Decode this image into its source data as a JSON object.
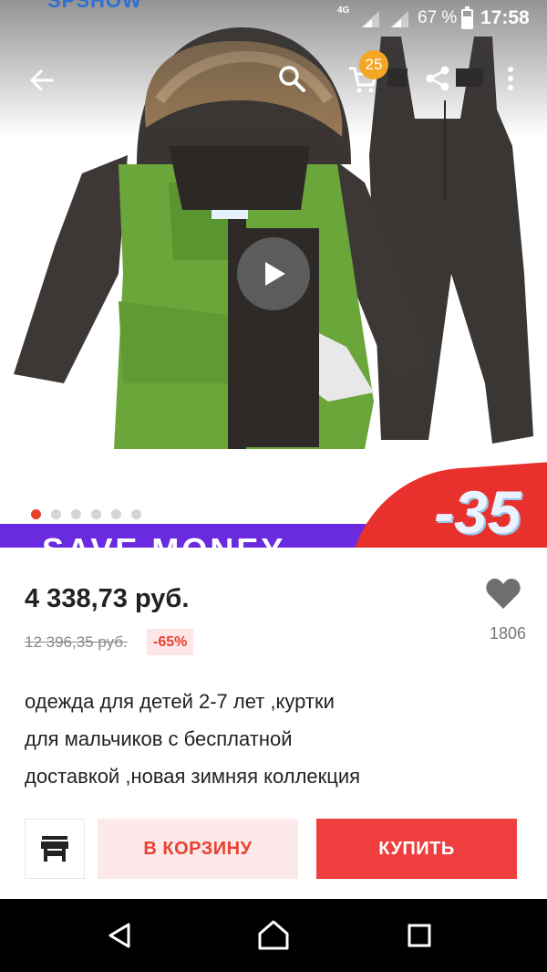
{
  "status_bar": {
    "network": "4G",
    "battery_percent": "67 %",
    "battery_level": 0.67,
    "time": "17:58"
  },
  "brand_clip_text": "SPSHOW",
  "toolbar": {
    "back_icon": "arrow-left-icon",
    "search_icon": "search-icon",
    "cart_icon": "cart-icon",
    "cart_count": "25",
    "share_icon": "share-icon",
    "more_icon": "more-vertical-icon"
  },
  "gallery": {
    "image_count": 6,
    "active_index": 0,
    "play_icon": "play-icon",
    "banner_text": "SAVE MONEY",
    "promo_text": "-35"
  },
  "product": {
    "price": "4 338,73 руб.",
    "old_price": "12 396,35 руб.",
    "discount": "-65%",
    "wishlist_count": "1806",
    "title": "одежда для детей 2-7 лет ,куртки\nдля мальчиков с бесплатной\nдоставкой  ,новая зимняя  коллекция"
  },
  "actions": {
    "store_icon": "store-icon",
    "add_to_cart_label": "В КОРЗИНУ",
    "buy_label": "КУПИТЬ"
  },
  "colors": {
    "accent_red": "#ef3e3e",
    "badge_orange": "#f5a623",
    "banner_purple": "#6a2adf"
  }
}
